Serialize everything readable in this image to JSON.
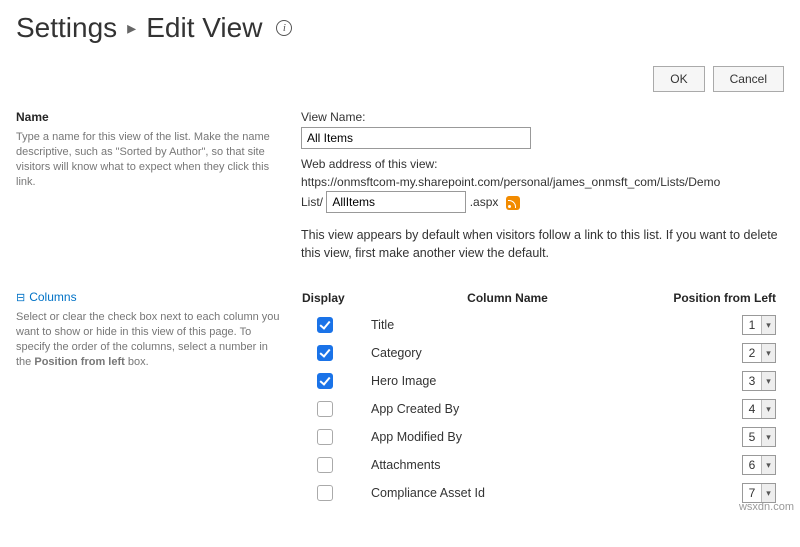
{
  "header": {
    "section": "Settings",
    "separator": "▸",
    "title": "Edit View",
    "info_glyph": "i"
  },
  "buttons": {
    "ok": "OK",
    "cancel": "Cancel"
  },
  "name_section": {
    "heading": "Name",
    "help": "Type a name for this view of the list. Make the name descriptive, such as \"Sorted by Author\", so that site visitors will know what to expect when they click this link.",
    "view_name_label": "View Name:",
    "view_name_value": "All Items",
    "web_address_label": "Web address of this view:",
    "web_url_line1": "https://onmsftcom-my.sharepoint.com/personal/james_onmsft_com/Lists/Demo",
    "web_url_line2_prefix": "List/",
    "web_url_slug_value": "AllItems",
    "web_url_suffix": ".aspx",
    "default_note": "This view appears by default when visitors follow a link to this list. If you want to delete this view, first make another view the default."
  },
  "columns_section": {
    "collapse_glyph": "⊟",
    "heading": "Columns",
    "help_prefix": "Select or clear the check box next to each column you want to show or hide in this view of this page. To specify the order of the columns, select a number in the ",
    "help_bold": "Position from left",
    "help_suffix": " box.",
    "th_display": "Display",
    "th_name": "Column Name",
    "th_position": "Position from Left",
    "rows": [
      {
        "checked": true,
        "name": "Title",
        "pos": "1"
      },
      {
        "checked": true,
        "name": "Category",
        "pos": "2"
      },
      {
        "checked": true,
        "name": "Hero Image",
        "pos": "3"
      },
      {
        "checked": false,
        "name": "App Created By",
        "pos": "4"
      },
      {
        "checked": false,
        "name": "App Modified By",
        "pos": "5"
      },
      {
        "checked": false,
        "name": "Attachments",
        "pos": "6"
      },
      {
        "checked": false,
        "name": "Compliance Asset Id",
        "pos": "7"
      }
    ]
  },
  "watermark": "wsxdn.com"
}
